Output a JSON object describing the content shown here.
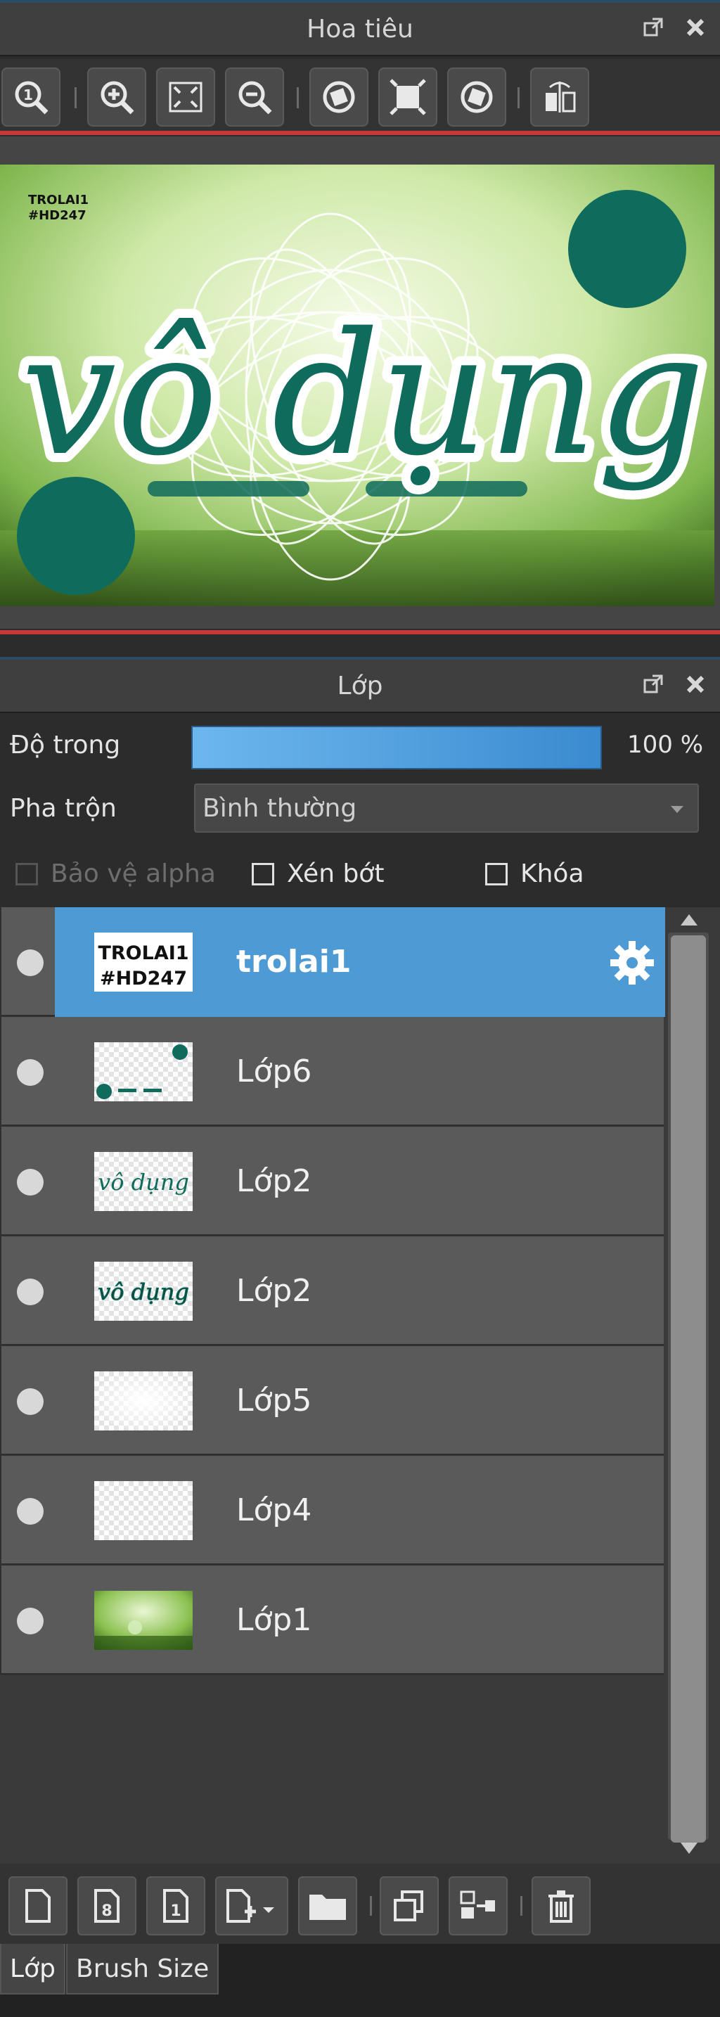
{
  "navigator": {
    "title": "Hoa tiêu",
    "toolbar_icons": [
      "zoom-actual-icon",
      "zoom-in-icon",
      "fit-screen-icon",
      "zoom-out-icon",
      "rotate-left-icon",
      "fit-window-icon",
      "rotate-right-icon",
      "flip-icon"
    ]
  },
  "layers_panel": {
    "title": "Lớp",
    "opacity_label": "Độ trong",
    "opacity_value": "100 %",
    "opacity_fraction": 1.0,
    "blend_label": "Pha trộn",
    "blend_value": "Bình thường",
    "protect_alpha_label": "Bảo vệ alpha",
    "clip_label": "Xén bớt",
    "lock_label": "Khóa",
    "layers": [
      {
        "name": "trolai1",
        "selected": true,
        "thumb": "text",
        "thumb_text": "TROLAI1 #HD247"
      },
      {
        "name": "Lớp6",
        "selected": false,
        "thumb": "circles"
      },
      {
        "name": "Lớp2",
        "selected": false,
        "thumb": "script",
        "thumb_text": "vô dụng"
      },
      {
        "name": "Lớp2",
        "selected": false,
        "thumb": "script",
        "thumb_text": "vô dụng"
      },
      {
        "name": "Lớp5",
        "selected": false,
        "thumb": "glow"
      },
      {
        "name": "Lớp4",
        "selected": false,
        "thumb": "empty"
      },
      {
        "name": "Lớp1",
        "selected": false,
        "thumb": "photo"
      }
    ]
  },
  "canvas_preview": {
    "watermark_line1": "TROLAI1",
    "watermark_line2": "#HD247",
    "main_text": "vô dụng"
  },
  "bottom_toolbar": {
    "icons": [
      "new-layer-icon",
      "new-8bit-layer-icon",
      "new-1bit-layer-icon",
      "add-layer-menu-icon",
      "folder-icon",
      "duplicate-icon",
      "merge-down-icon",
      "delete-icon"
    ]
  },
  "tabs": [
    {
      "label": "Lớp",
      "active": true
    },
    {
      "label": "Brush Size",
      "active": false
    }
  ],
  "colors": {
    "accent": "#4d9ad4",
    "teal": "#0f6b5c",
    "panel": "#3f3f3f"
  }
}
